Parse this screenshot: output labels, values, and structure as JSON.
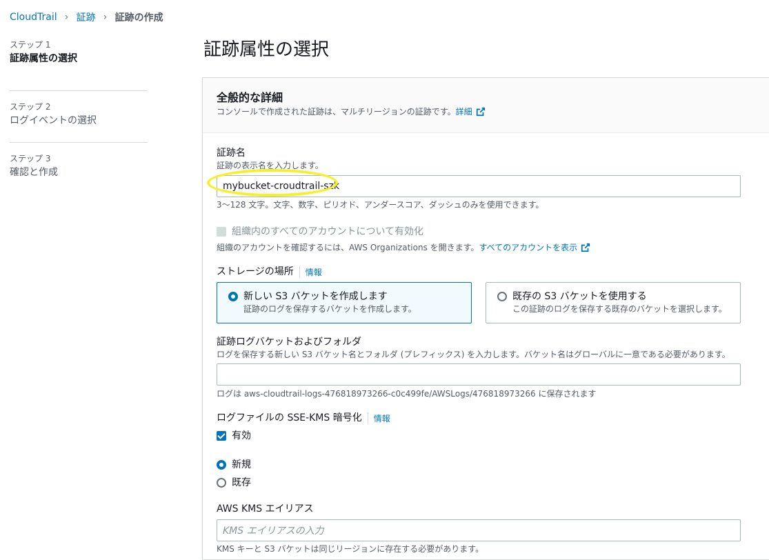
{
  "breadcrumb": {
    "items": [
      "CloudTrail",
      "証跡",
      "証跡の作成"
    ]
  },
  "steps": [
    {
      "label": "ステップ 1",
      "name": "証跡属性の選択"
    },
    {
      "label": "ステップ 2",
      "name": "ログイベントの選択"
    },
    {
      "label": "ステップ 3",
      "name": "確認と作成"
    }
  ],
  "page_title": "証跡属性の選択",
  "general": {
    "title": "全般的な詳細",
    "description": "コンソールで作成された証跡は、マルチリージョンの証跡です。",
    "learn_more": "詳細"
  },
  "trail_name": {
    "label": "証跡名",
    "description": "証跡の表示名を入力します。",
    "value": "mybucket-croudtrail-szk",
    "constraint": "3〜128 文字。文字、数字、ピリオド、アンダースコア、ダッシュのみを使用できます。"
  },
  "org": {
    "label": "組織内のすべてのアカウントについて有効化",
    "description": "組織のアカウントを確認するには、AWS Organizations を開きます。",
    "link": "すべてのアカウントを表示"
  },
  "storage": {
    "label": "ストレージの場所",
    "info": "情報",
    "new_title": "新しい S3 バケットを作成します",
    "new_desc": "証跡のログを保存するバケットを作成します。",
    "existing_title": "既存の S3 バケットを使用する",
    "existing_desc": "この証跡のログを保存する既存のバケットを選択します。"
  },
  "bucket": {
    "label": "証跡ログバケットおよびフォルダ",
    "description": "ログを保存する新しい S3 バケット名とフォルダ (プレフィックス) を入力します。バケット名はグローバルに一意である必要があります。",
    "value": "",
    "hint": "ログは aws-cloudtrail-logs-476818973266-c0c499fe/AWSLogs/476818973266 に保存されます"
  },
  "sse": {
    "label": "ログファイルの SSE-KMS 暗号化",
    "info": "情報",
    "enabled": "有効",
    "new": "新規",
    "existing": "既存"
  },
  "kms": {
    "label": "AWS KMS エイリアス",
    "placeholder": "KMS エイリアスの入力",
    "hint": "KMS キーと S3 バケットは同じリージョンに存在する必要があります。"
  },
  "colors": {
    "link": "#0073bb",
    "highlight": "#f5f02a"
  }
}
